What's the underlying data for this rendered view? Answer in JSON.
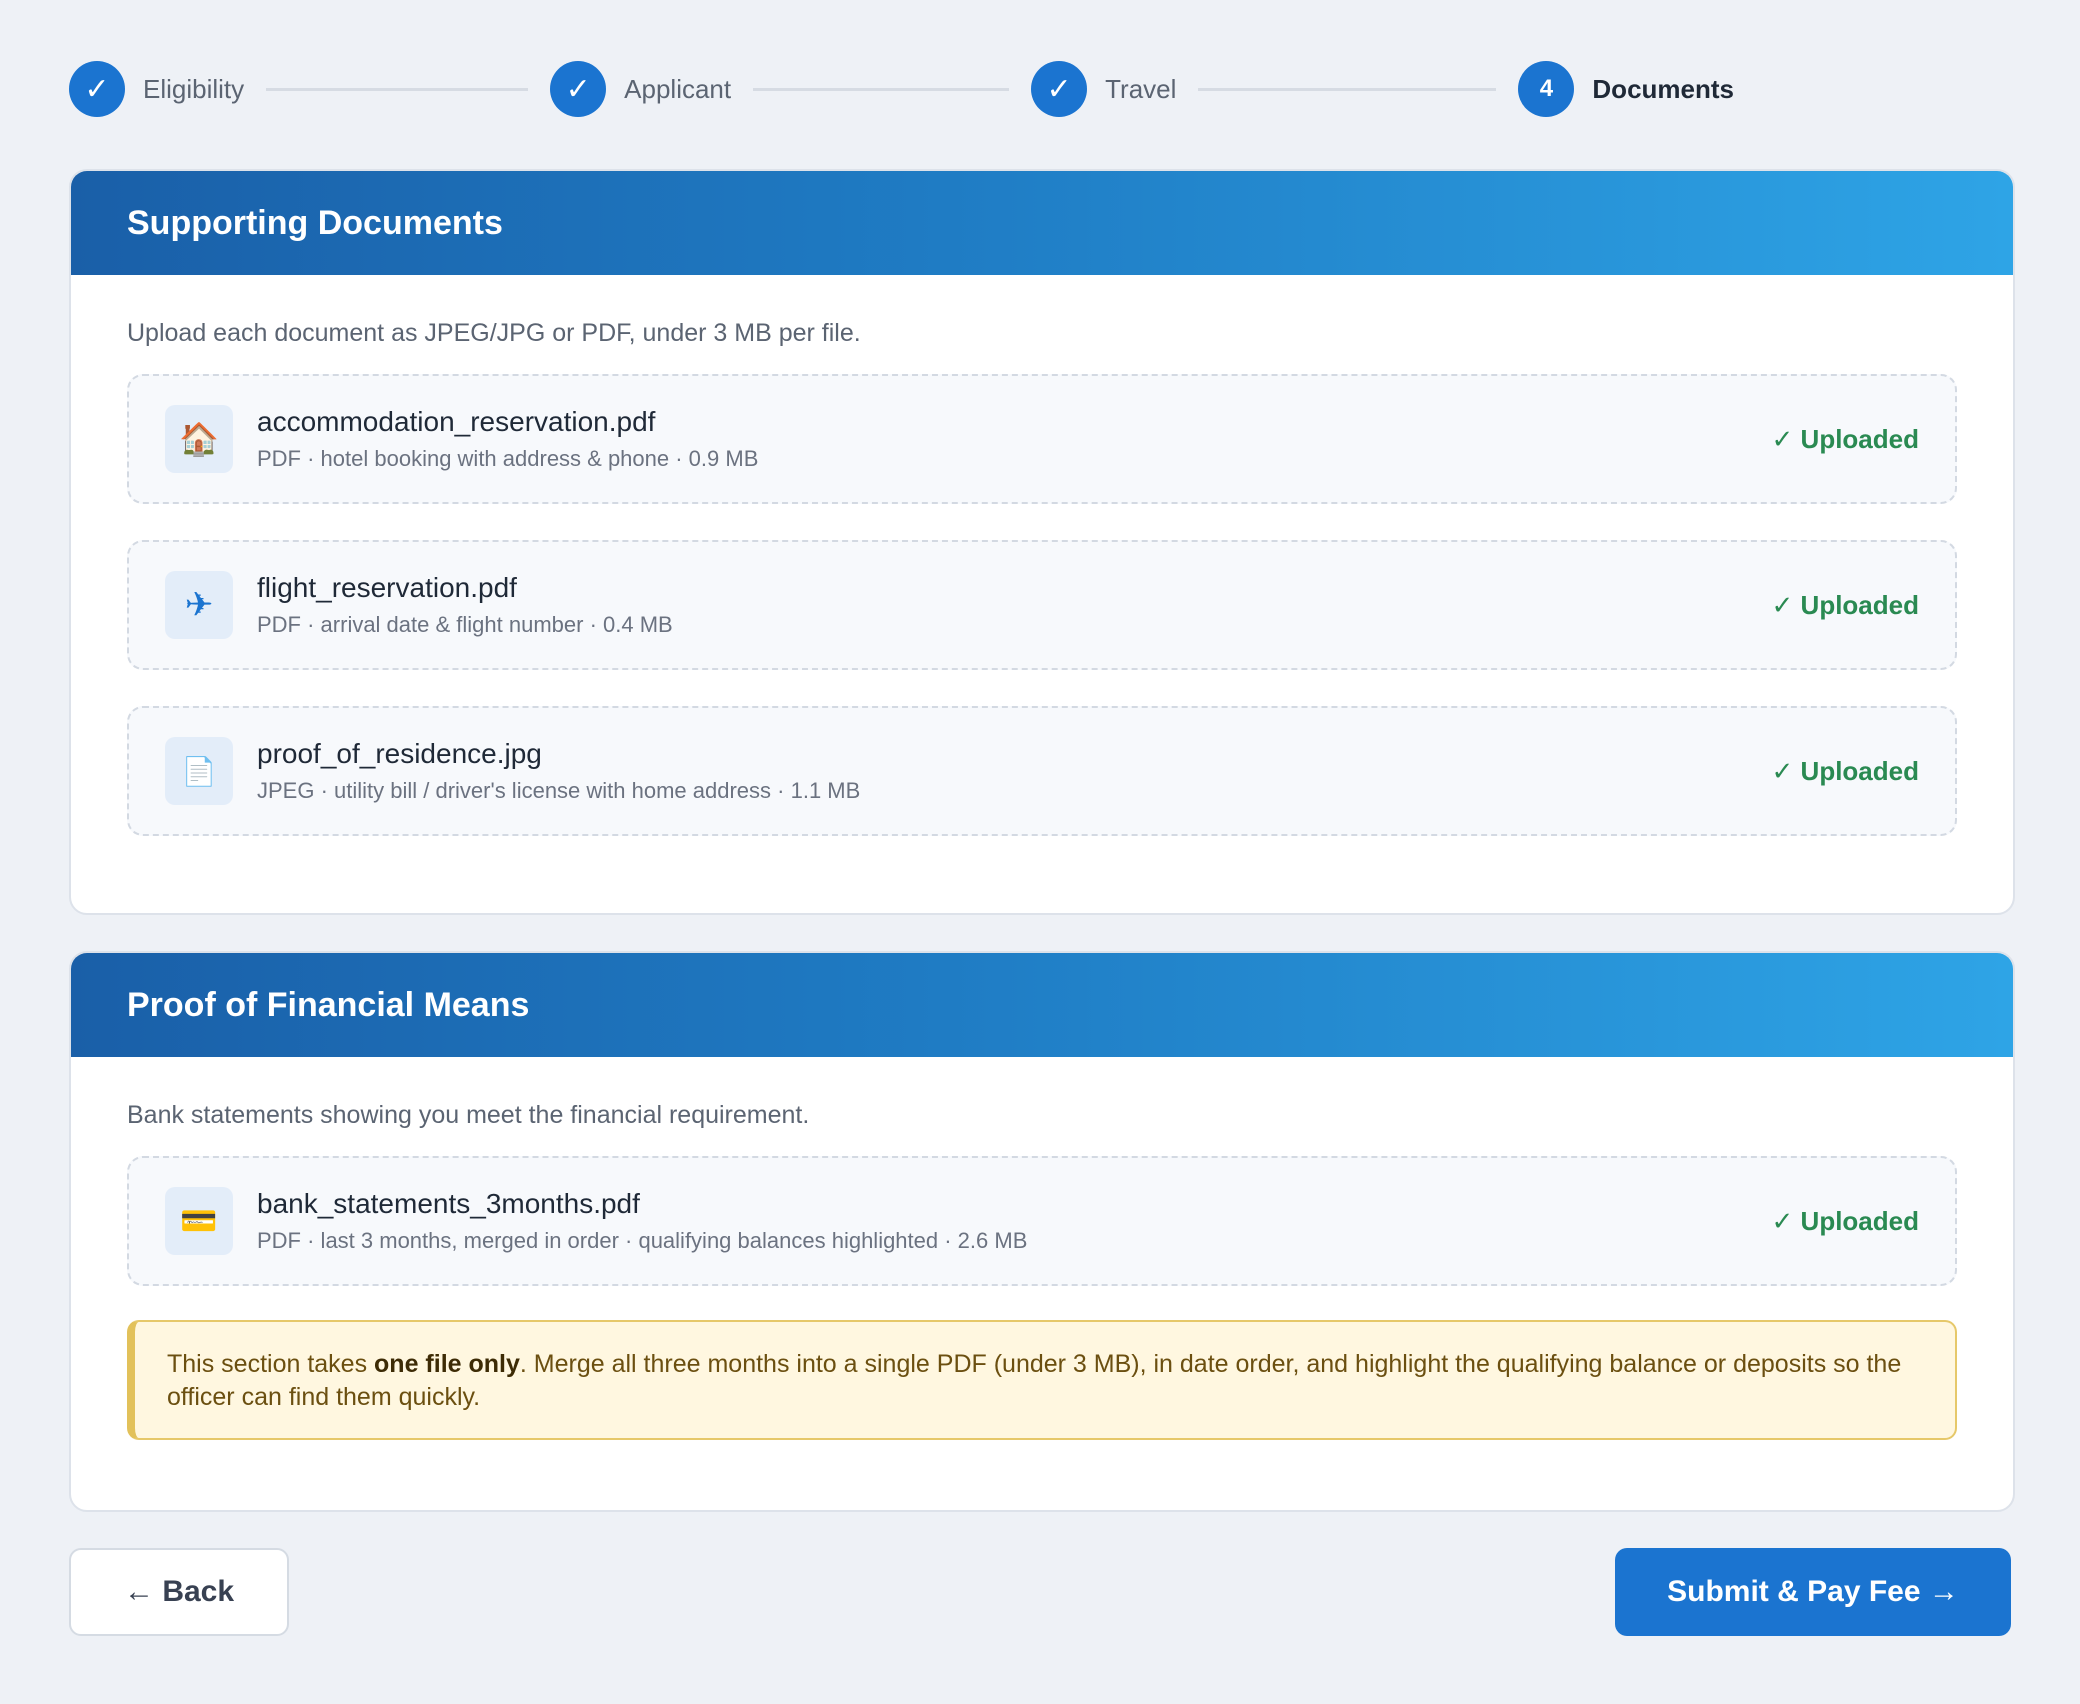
{
  "stepper": {
    "steps": [
      {
        "label": "Eligibility",
        "status": "complete",
        "mark": "✓"
      },
      {
        "label": "Applicant",
        "status": "complete",
        "mark": "✓"
      },
      {
        "label": "Travel",
        "status": "complete",
        "mark": "✓"
      },
      {
        "label": "Documents",
        "status": "current",
        "mark": "4"
      }
    ]
  },
  "supporting": {
    "title": "Supporting Documents",
    "intro": "Upload each document as JPEG/JPG or PDF, under 3 MB per file.",
    "documents": [
      {
        "icon": "house-icon",
        "glyph": "🏠",
        "name": "accommodation_reservation.pdf",
        "meta": "PDF · hotel booking with address & phone · 0.9 MB",
        "status": "✓ Uploaded"
      },
      {
        "icon": "airplane-icon",
        "glyph": "✈",
        "name": "flight_reservation.pdf",
        "meta": "PDF · arrival date & flight number · 0.4 MB",
        "status": "✓ Uploaded"
      },
      {
        "icon": "document-icon",
        "glyph": "📄",
        "name": "proof_of_residence.jpg",
        "meta": "JPEG · utility bill / driver's license with home address · 1.1 MB",
        "status": "✓ Uploaded"
      }
    ]
  },
  "financial": {
    "title": "Proof of Financial Means",
    "intro": "Bank statements showing you meet the financial requirement.",
    "documents": [
      {
        "icon": "credit-card-icon",
        "glyph": "💳",
        "name": "bank_statements_3months.pdf",
        "meta": "PDF · last 3 months, merged in order · qualifying balances highlighted · 2.6 MB",
        "status": "✓ Uploaded"
      }
    ],
    "notice": {
      "prefix": "This section takes ",
      "emphasis": "one file only",
      "suffix": ". Merge all three months into a single PDF (under 3 MB), in date order, and highlight the qualifying balance or deposits so the officer can find them quickly."
    }
  },
  "actions": {
    "back_arrow": "←",
    "back_label": "Back",
    "submit_label": "Submit & Pay Fee",
    "submit_arrow": "→"
  },
  "colors": {
    "accent": "#1b74d0",
    "success": "#2a8a52",
    "notice_border": "#e2c15a",
    "notice_bg": "#fff7e0"
  }
}
